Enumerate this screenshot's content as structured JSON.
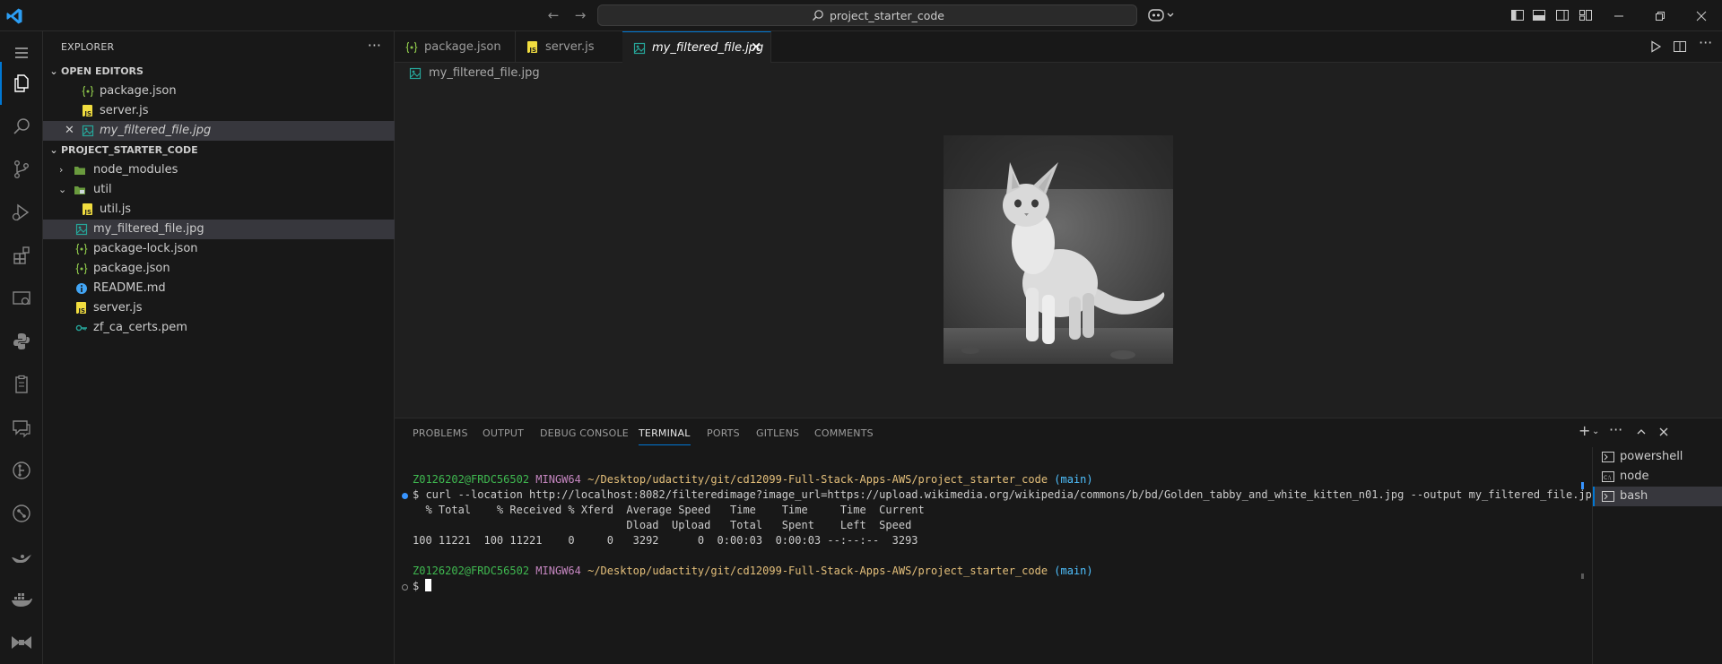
{
  "titlebar": {
    "search_text": "project_starter_code"
  },
  "sidebar": {
    "title": "EXPLORER",
    "open_editors_label": "OPEN EDITORS",
    "open_editors": [
      {
        "label": "package.json",
        "icon": "json-icon"
      },
      {
        "label": "server.js",
        "icon": "js-icon"
      },
      {
        "label": "my_filtered_file.jpg",
        "icon": "image-icon"
      }
    ],
    "project_label": "PROJECT_STARTER_CODE",
    "tree": [
      {
        "label": "node_modules",
        "icon": "folder-icon"
      },
      {
        "label": "util",
        "icon": "folder-icon"
      },
      {
        "label": "util.js",
        "icon": "js-icon"
      },
      {
        "label": "my_filtered_file.jpg",
        "icon": "image-icon"
      },
      {
        "label": "package-lock.json",
        "icon": "json-icon"
      },
      {
        "label": "package.json",
        "icon": "json-icon"
      },
      {
        "label": "README.md",
        "icon": "info-icon"
      },
      {
        "label": "server.js",
        "icon": "js-icon"
      },
      {
        "label": "zf_ca_certs.pem",
        "icon": "key-icon"
      }
    ]
  },
  "editor": {
    "tabs": [
      {
        "label": "package.json"
      },
      {
        "label": "server.js"
      },
      {
        "label": "my_filtered_file.jpg"
      }
    ],
    "breadcrumb": "my_filtered_file.jpg"
  },
  "panel": {
    "tabs": [
      "PROBLEMS",
      "OUTPUT",
      "DEBUG CONSOLE",
      "TERMINAL",
      "PORTS",
      "GITLENS",
      "COMMENTS"
    ],
    "terminal": {
      "user_host": "Z0126202@FRDC56502",
      "shell": "MINGW64",
      "path": "~/Desktop/udactity/git/cd12099-Full-Stack-Apps-AWS/project_starter_code",
      "branch": "(main)",
      "command": "$ curl --location http://localhost:8082/filteredimage?image_url=https://upload.wikimedia.org/wikipedia/commons/b/bd/Golden_tabby_and_white_kitten_n01.jpg --output my_filtered_file.jpg",
      "header1": "  % Total    % Received % Xferd  Average Speed   Time    Time     Time  Current",
      "header2": "                                 Dload  Upload   Total   Spent    Left  Speed",
      "progress": "100 11221  100 11221    0     0   3292      0  0:00:03  0:00:03 --:--:--  3293",
      "prompt": "$ "
    },
    "terminals": [
      "powershell",
      "node",
      "bash"
    ]
  },
  "colors": {
    "accent": "#0078d4",
    "js": "#f1dd3f",
    "json": "#8bc34a",
    "image": "#26a69a",
    "info": "#42a5f5"
  }
}
